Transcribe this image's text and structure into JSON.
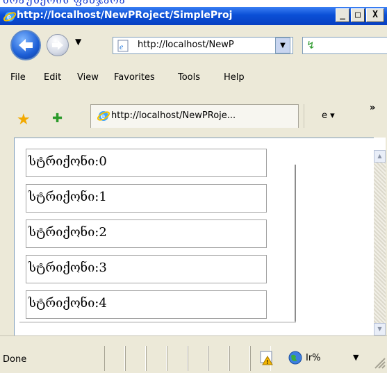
{
  "caption": {
    "text": "ბრაუზერის ფანჯარა"
  },
  "window": {
    "title": "http://localhost/NewPRoject/SimpleProj",
    "controls": {
      "minimize": "_",
      "maximize": "□",
      "close": "X"
    }
  },
  "address_bar": {
    "url": "http://localhost/NewP"
  },
  "menu": {
    "items": [
      "File",
      "Edit",
      "View",
      "Favorites",
      "Tools",
      "Help"
    ]
  },
  "tabs": {
    "active_title": "http://localhost/NewPRoje...",
    "page_menu": "e ▾",
    "overflow": "»"
  },
  "content": {
    "items": [
      "სტრიქონი:0",
      "სტრიქონი:1",
      "სტრიქონი:2",
      "სტრიქონი:3",
      "სტრიქონი:4"
    ]
  },
  "status_bar": {
    "status": "Done",
    "zone": "Ir%"
  },
  "colors": {
    "title_bar": "#0a4fd6",
    "chrome": "#ece9d8",
    "frame_border": "#7f9db9"
  }
}
